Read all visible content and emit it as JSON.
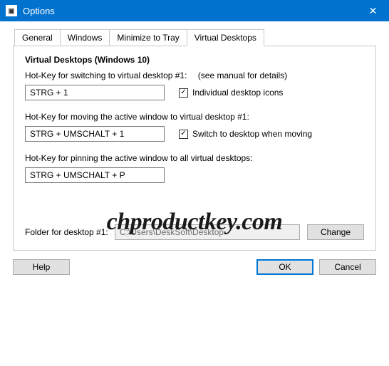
{
  "window": {
    "title": "Options"
  },
  "tabs": [
    {
      "label": "General"
    },
    {
      "label": "Windows"
    },
    {
      "label": "Minimize to Tray"
    },
    {
      "label": "Virtual Desktops"
    }
  ],
  "section": {
    "heading": "Virtual Desktops (Windows 10)",
    "switch_label": "Hot-Key for switching to virtual desktop #1:",
    "switch_hint": "(see manual for details)",
    "switch_value": "STRG + 1",
    "individual_icons_label": "Individual desktop icons",
    "individual_icons_checked": true,
    "move_label": "Hot-Key for moving the active window to virtual desktop #1:",
    "move_value": "STRG + UMSCHALT + 1",
    "switch_when_moving_label": "Switch to desktop when moving",
    "switch_when_moving_checked": true,
    "pin_label": "Hot-Key for pinning the active window to all virtual desktops:",
    "pin_value": "STRG + UMSCHALT + P",
    "folder_label": "Folder for desktop #1:",
    "folder_value": "C:\\Users\\DeskSoft\\Desktop",
    "change_label": "Change"
  },
  "buttons": {
    "help": "Help",
    "ok": "OK",
    "cancel": "Cancel"
  },
  "watermark": "chproductkey.com"
}
